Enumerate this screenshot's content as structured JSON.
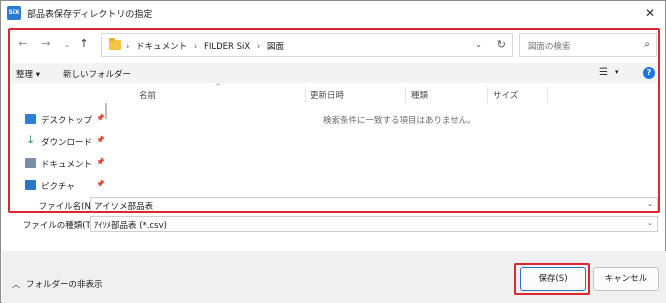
{
  "titlebar": {
    "title": "部品表保存ディレクトリの指定",
    "app_icon": "SiX",
    "close": "✕"
  },
  "nav": {
    "back": "←",
    "forward": "→",
    "recent": "⌄",
    "up": "↑",
    "breadcrumbs": [
      "ドキュメント",
      "FILDER SiX",
      "図面"
    ],
    "separator": "›",
    "search_placeholder": "図面の検索",
    "dropdown": "⌄",
    "refresh": "↻",
    "search_glyph": "⌕"
  },
  "toolbar": {
    "organize": "整理 ▾",
    "new_folder": "新しいフォルダー",
    "view_glyph": "☰",
    "view_drop": "▾",
    "help": "?"
  },
  "sidebar": {
    "items": [
      {
        "label": "デスクトップ",
        "icon": "desktop-icon"
      },
      {
        "label": "ダウンロード",
        "icon": "download-icon"
      },
      {
        "label": "ドキュメント",
        "icon": "documents-icon"
      },
      {
        "label": "ピクチャ",
        "icon": "pictures-icon"
      }
    ],
    "pin": "📌"
  },
  "filelist": {
    "columns": [
      "名前",
      "更新日時",
      "種類",
      "サイズ"
    ],
    "sort_glyph": "^",
    "empty_message": "検索条件に一致する項目はありません。"
  },
  "filename": {
    "label": "ファイル名(N):",
    "value": "アイソメ部品表"
  },
  "filetype": {
    "label": "ファイルの種類(T):",
    "value": "ｱｲｿﾒ部品表 (*.csv)"
  },
  "footer": {
    "hide_folders": "フォルダーの非表示",
    "hide_chevron": "︿",
    "save": "保存(S)",
    "cancel": "キャンセル"
  },
  "colors": {
    "highlight": "#d9282f",
    "accent": "#2b79d0"
  }
}
